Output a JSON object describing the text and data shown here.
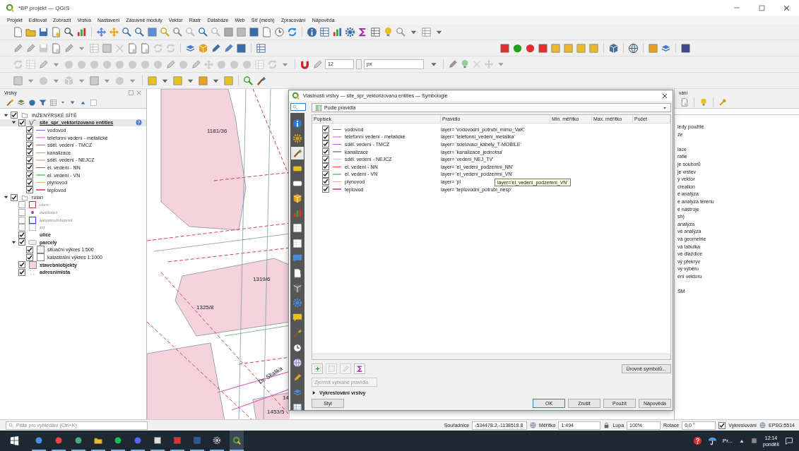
{
  "window": {
    "title": "*BP projekt — QGIS"
  },
  "menu": [
    "Projekt",
    "Editovat",
    "Zobrazit",
    "Vrstva",
    "Nastavení",
    "Zásuvné moduly",
    "Vektor",
    "Rastr",
    "Databáze",
    "Web",
    "Síť (mesh)",
    "Zpracování",
    "Nápověda"
  ],
  "toolbar": {
    "size_value": "12",
    "unit": "px"
  },
  "layers_panel": {
    "title": "Vrstvy",
    "tree": [
      {
        "kind": "group",
        "label": "INŽENÝRSKÉ SÍTĚ",
        "checked": true,
        "expanded": true,
        "selected": false,
        "children": [
          {
            "kind": "vector",
            "label": "site_spr_vektorizovano entities",
            "checked": true,
            "expanded": true,
            "selected": true,
            "children": [
              {
                "kind": "line",
                "label": "vodovod",
                "checked": true,
                "selected": false,
                "color": "#6a6ae0"
              },
              {
                "kind": "line",
                "label": "telefonní vedení - metalické",
                "checked": true,
                "selected": false,
                "color": "#f0a0f0"
              },
              {
                "kind": "line",
                "label": "sděl. vedení - TMCZ",
                "checked": true,
                "selected": false,
                "color": "#b060e0"
              },
              {
                "kind": "line",
                "label": "kanalizace",
                "checked": true,
                "selected": false,
                "color": "#c0a080"
              },
              {
                "kind": "line",
                "label": "sděl. vedení - NEJCZ",
                "checked": true,
                "selected": false,
                "color": "#f0c0c0"
              },
              {
                "kind": "line",
                "label": "el. vedení - NN",
                "checked": true,
                "selected": false,
                "color": "#f04040"
              },
              {
                "kind": "line",
                "label": "el. vedení - VN",
                "checked": true,
                "selected": false,
                "color": "#80e080"
              },
              {
                "kind": "line",
                "label": "plynovod",
                "checked": true,
                "selected": false,
                "color": "#e0c060"
              },
              {
                "kind": "line",
                "label": "teplovod",
                "checked": true,
                "selected": false,
                "color": "#e06080"
              }
            ]
          }
        ]
      },
      {
        "kind": "group",
        "label": "ruian",
        "checked": true,
        "expanded": true,
        "selected": false,
        "children": [
          {
            "kind": "polygon",
            "label": "obce",
            "checked": false,
            "selected": false,
            "color": "#e03030"
          },
          {
            "kind": "point",
            "label": "castiobci",
            "checked": false,
            "selected": false,
            "color": "#9040a0"
          },
          {
            "kind": "polygon",
            "label": "katastralniuzemi",
            "checked": false,
            "selected": false,
            "color": "#3040e0"
          },
          {
            "kind": "polygon",
            "label": "zsj",
            "checked": false,
            "selected": false,
            "color": "#f0b0b0"
          },
          {
            "kind": "plain",
            "label": "ulice",
            "checked": true,
            "selected": false
          },
          {
            "kind": "raster",
            "label": "parcely",
            "checked": true,
            "expanded": true,
            "selected": false,
            "children": [
              {
                "kind": "class",
                "label": "situační výkres 1:500",
                "checked": true,
                "selected": false,
                "color": "#eef4f8"
              },
              {
                "kind": "class",
                "label": "katastrální výkres 1:1000",
                "checked": true,
                "selected": false,
                "color": "#ffffff"
              }
            ]
          },
          {
            "kind": "fill",
            "label": "stavebniobjekty",
            "checked": true,
            "selected": false,
            "color": "#f5d5dd"
          },
          {
            "kind": "points",
            "label": "adresnimista",
            "checked": true,
            "selected": false
          }
        ]
      }
    ]
  },
  "map": {
    "labels": [
      "1181/36",
      "1319/6",
      "1325/8",
      "Dr. Skalika",
      "1453/5",
      "14"
    ]
  },
  "dialog": {
    "title": "Vlastnosti vrstvy — site_spr_vektorizovano entities — Symbologie",
    "side_tabs": [
      {
        "selected": false
      },
      {
        "selected": false
      },
      {
        "selected": true
      },
      {
        "selected": false
      },
      {
        "selected": false
      },
      {
        "selected": false
      },
      {
        "selected": false
      },
      {
        "selected": false
      },
      {
        "selected": false
      },
      {
        "selected": false
      },
      {
        "selected": false
      },
      {
        "selected": false
      },
      {
        "selected": false
      },
      {
        "selected": false
      },
      {
        "selected": false
      },
      {
        "selected": false
      },
      {
        "selected": false
      },
      {
        "selected": false
      },
      {
        "selected": false
      },
      {
        "selected": false
      }
    ],
    "renderer": "Podle pravidla",
    "columns": [
      "Popisek",
      "Pravidlo",
      "Min. měřítko",
      "Max. měřítko",
      "Počet"
    ],
    "rules": [
      {
        "checked": true,
        "color": "#6a6ae0",
        "label": "vodovod",
        "rule": "layer= 'vodovodni_potrubi_mimo_VaK'"
      },
      {
        "checked": true,
        "color": "#f0a0f0",
        "label": "telefonní vedení - metalické",
        "rule": "layer= 'telefonni_vedeni_metalika'"
      },
      {
        "checked": true,
        "color": "#b060e0",
        "label": "sděl. vedení - TMCZ",
        "rule": "layer= 'sdelovaci_kabely_T-MOBILE'"
      },
      {
        "checked": true,
        "color": "#c0a080",
        "label": "kanalizace",
        "rule": "layer= 'kanalizace_jednotna'"
      },
      {
        "checked": true,
        "color": "#f0c0c0",
        "label": "sděl. vedení - NEJCZ",
        "rule": "layer= 'vedeni_NEJ_TV'"
      },
      {
        "checked": true,
        "color": "#f04040",
        "label": "el. vedení - NN",
        "rule": "layer= 'el_vedeni_podzemni_NN'"
      },
      {
        "checked": true,
        "color": "#80e080",
        "label": "el. vedení - VN",
        "rule": "layer= 'el_vedeni_podzemni_VN'"
      },
      {
        "checked": true,
        "color": "#e0c060",
        "label": "plynovod",
        "rule": "layer= 'pl"
      },
      {
        "checked": true,
        "color": "#e06080",
        "label": "teplovod",
        "rule": "layer= 'teplovodni_potrubi_nesp'"
      }
    ],
    "tooltip": "layer='el_vedeni_podzemni_VN'",
    "symbol_levels_button": "Úrovně symbolů...",
    "refine_dropdown": {
      "label": "Zjemnit vybrané pravidla",
      "disabled": true
    },
    "rendering_section": {
      "label": "Vykreslování vrstvy",
      "expanded": false
    },
    "style_button": "Styl",
    "buttons": [
      "OK",
      "Zrušit",
      "Použít",
      "Nápověda"
    ]
  },
  "right_panel": {
    "title": "vání",
    "items": [
      "ledy použité",
      "ze",
      "lace",
      "rafie",
      "je souborů",
      "je vrstev",
      "ý vektor",
      "creation",
      "é analýza",
      "é analýza terénu",
      "é nástroje",
      "sh)",
      "analýza",
      "vé analýza",
      "vá geometrie",
      "vá tabulka",
      "vé dlaždice",
      "vý překryv",
      "vý výběru",
      "ení vektoru",
      "SM"
    ]
  },
  "status_bar": {
    "search_placeholder": "Pište pro vyhledání (Ctrl+K)",
    "coordinate_label": "Souřadnice",
    "coordinate": "-534478.2,-1138518.8",
    "scale_label": "Měřítko",
    "scale": "1:494",
    "magnifier_label": "Lupa",
    "magnifier": "100%",
    "rotation_label": "Rotace",
    "rotation": "0,0 °",
    "render": {
      "label": "Vykreslování",
      "checked": true
    },
    "crs": "EPSG:5514"
  },
  "taskbar": {
    "tray_text": "Pr...",
    "time": "12:14",
    "day": "pondělí"
  }
}
